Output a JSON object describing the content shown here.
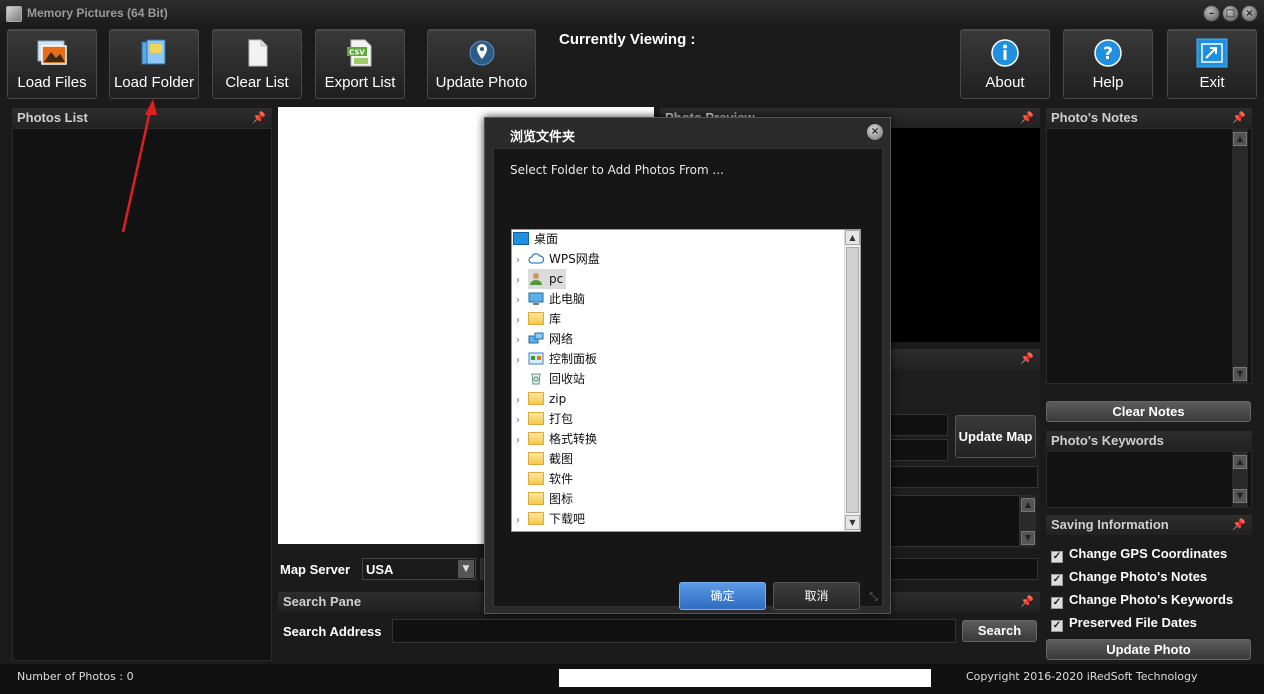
{
  "window": {
    "title": "Memory Pictures  (64 Bit)"
  },
  "toolbar": {
    "buttons": [
      {
        "label": "Load Files",
        "icon": "photos-icon"
      },
      {
        "label": "Load Folder",
        "icon": "folder-icon"
      },
      {
        "label": "Clear List",
        "icon": "blank-page-icon"
      },
      {
        "label": "Export List",
        "icon": "csv-icon"
      },
      {
        "label": "Update Photo",
        "icon": "location-pin-icon"
      },
      {
        "label": "About",
        "icon": "info-icon"
      },
      {
        "label": "Help",
        "icon": "help-icon"
      },
      {
        "label": "Exit",
        "icon": "exit-icon"
      }
    ],
    "currently_viewing": "Currently Viewing :"
  },
  "photos_list": {
    "title": "Photos List"
  },
  "photo_preview": {
    "title": "Photo Preview"
  },
  "photo_notes": {
    "title": "Photo's Notes",
    "clear_button": "Clear Notes"
  },
  "photo_keywords": {
    "title": "Photo's Keywords"
  },
  "map": {
    "server_label": "Map Server",
    "server_value": "USA",
    "update_map_button": "Update Map"
  },
  "search_pane": {
    "title": "Search Pane",
    "address_label": "Search Address",
    "address_value": "",
    "search_button": "Search"
  },
  "saving_info": {
    "title": "Saving Information",
    "options": [
      {
        "label": "Change GPS Coordinates",
        "checked": true
      },
      {
        "label": "Change Photo's Notes",
        "checked": true
      },
      {
        "label": "Change Photo's Keywords",
        "checked": true
      },
      {
        "label": "Preserved File Dates",
        "checked": true
      }
    ],
    "update_button": "Update Photo"
  },
  "dialog": {
    "title": "浏览文件夹",
    "instruction": "Select Folder to Add Photos From ...",
    "tree": [
      {
        "label": "桌面",
        "icon": "desktop-icon",
        "expandable": false,
        "level": 0
      },
      {
        "label": "WPS网盘",
        "icon": "cloud-icon",
        "expandable": true,
        "level": 1
      },
      {
        "label": "pc",
        "icon": "user-icon",
        "expandable": true,
        "level": 1,
        "selected": true
      },
      {
        "label": "此电脑",
        "icon": "computer-icon",
        "expandable": true,
        "level": 1
      },
      {
        "label": "库",
        "icon": "library-icon",
        "expandable": true,
        "level": 1
      },
      {
        "label": "网络",
        "icon": "network-icon",
        "expandable": true,
        "level": 1
      },
      {
        "label": "控制面板",
        "icon": "control-panel-icon",
        "expandable": true,
        "level": 1
      },
      {
        "label": "回收站",
        "icon": "recycle-bin-icon",
        "expandable": false,
        "level": 1
      },
      {
        "label": "zip",
        "icon": "folder-icon",
        "expandable": true,
        "level": 1
      },
      {
        "label": "打包",
        "icon": "folder-icon",
        "expandable": true,
        "level": 1
      },
      {
        "label": "格式转换",
        "icon": "folder-icon",
        "expandable": true,
        "level": 1
      },
      {
        "label": "截图",
        "icon": "folder-icon",
        "expandable": false,
        "level": 1
      },
      {
        "label": "软件",
        "icon": "folder-icon",
        "expandable": false,
        "level": 1
      },
      {
        "label": "图标",
        "icon": "folder-icon",
        "expandable": false,
        "level": 1
      },
      {
        "label": "下载吧",
        "icon": "folder-icon",
        "expandable": true,
        "level": 1
      }
    ],
    "ok_button": "确定",
    "cancel_button": "取消"
  },
  "status": {
    "photo_count": "Number of Photos : 0",
    "copyright": "Copyright 2016-2020 iRedSoft Technology"
  },
  "colors": {
    "background": "#1b1b1b",
    "accent_blue": "#1f8fe0",
    "annotation_arrow": "#e01f1f",
    "ok_button": "#3d7fd6"
  }
}
